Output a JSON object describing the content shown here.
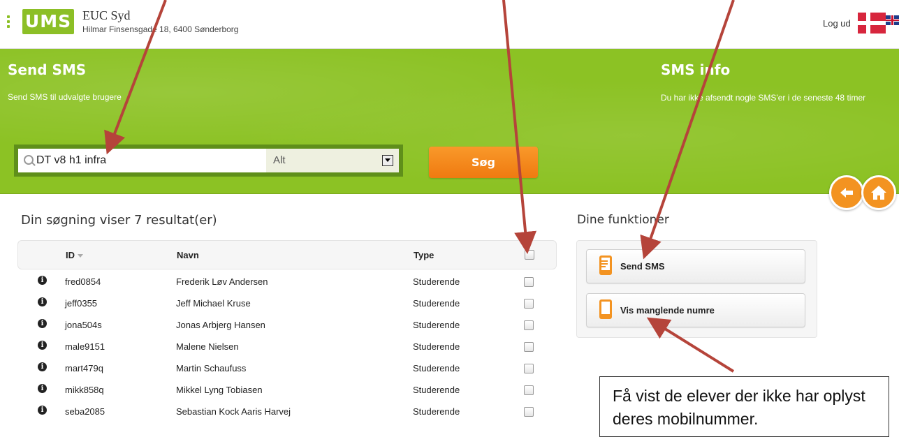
{
  "header": {
    "logo_text": "UMS",
    "school_name": "EUC Syd",
    "school_address": "Hilmar Finsensgade 18, 6400 Sønderborg",
    "logout_label": "Log ud"
  },
  "banner": {
    "send_sms_title": "Send SMS",
    "send_sms_subtitle": "Send SMS til udvalgte brugere",
    "sms_info_title": "SMS info",
    "sms_info_text": "Du har ikke afsendt nogle SMS'er i de seneste 48 timer",
    "search_value": "DT v8 h1 infra",
    "filter_value": "Alt",
    "search_button": "Søg"
  },
  "results": {
    "title": "Din søgning viser 7 resultat(er)",
    "columns": {
      "id": "ID",
      "name": "Navn",
      "type": "Type"
    },
    "rows": [
      {
        "id": "fred0854",
        "name": "Frederik Løv Andersen",
        "type": "Studerende"
      },
      {
        "id": "jeff0355",
        "name": "Jeff Michael Kruse",
        "type": "Studerende"
      },
      {
        "id": "jona504s",
        "name": "Jonas Arbjerg Hansen",
        "type": "Studerende"
      },
      {
        "id": "male9151",
        "name": "Malene Nielsen",
        "type": "Studerende"
      },
      {
        "id": "mart479q",
        "name": "Martin Schaufuss",
        "type": "Studerende"
      },
      {
        "id": "mikk858q",
        "name": "Mikkel Lyng Tobiasen",
        "type": "Studerende"
      },
      {
        "id": "seba2085",
        "name": "Sebastian Kock Aaris Harvej",
        "type": "Studerende"
      }
    ]
  },
  "functions": {
    "title": "Dine funktioner",
    "send_sms": "Send SMS",
    "missing_numbers": "Vis manglende numre"
  },
  "annotation": {
    "text": "Få vist de elever der ikke har oplyst deres mobilnummer."
  },
  "colors": {
    "brand_green": "#8cc224",
    "accent_orange": "#f39321",
    "arrow_red": "#b5443a"
  },
  "icons": {
    "menu": "menu-dots-icon",
    "search": "search-icon",
    "back": "arrow-left-icon",
    "home": "home-icon",
    "info": "info-icon",
    "phone": "mobile-phone-icon"
  }
}
